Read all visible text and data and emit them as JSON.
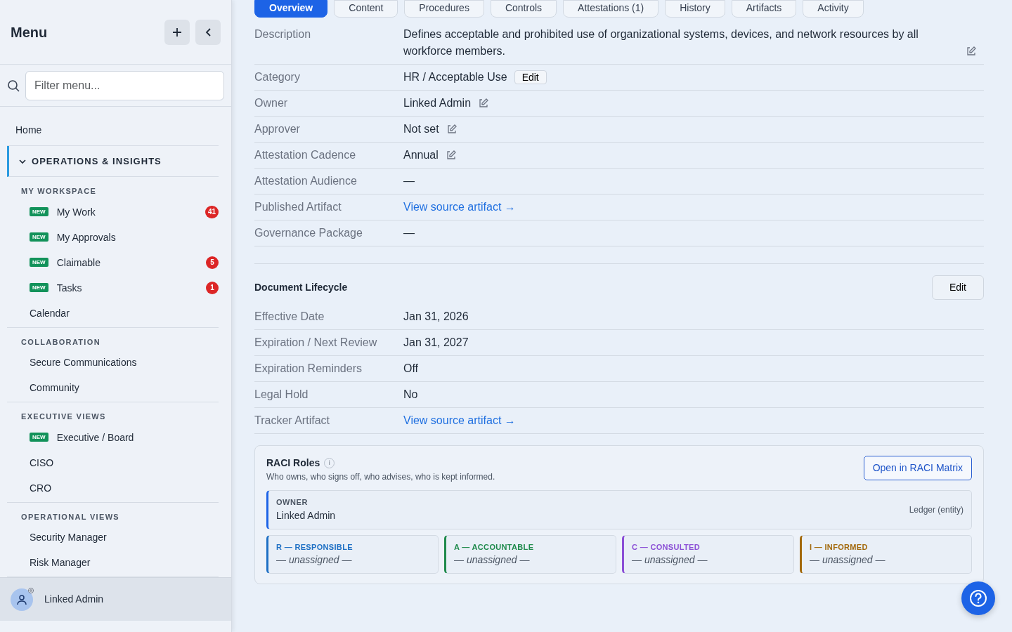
{
  "sidebar": {
    "title": "Menu",
    "filter": {
      "placeholder": "Filter menu..."
    },
    "home": "Home",
    "group": {
      "label": "OPERATIONS & INSIGHTS",
      "expanded": true
    },
    "sections": [
      {
        "title": "MY WORKSPACE",
        "items": [
          {
            "label": "My Work",
            "tag": "NEW",
            "count": "41"
          },
          {
            "label": "My Approvals",
            "tag": "NEW"
          },
          {
            "label": "Claimable",
            "tag": "NEW",
            "count": "5"
          },
          {
            "label": "Tasks",
            "tag": "NEW",
            "count": "1"
          },
          {
            "label": "Calendar"
          }
        ]
      },
      {
        "title": "COLLABORATION",
        "items": [
          {
            "label": "Secure Communications"
          },
          {
            "label": "Community"
          }
        ]
      },
      {
        "title": "EXECUTIVE VIEWS",
        "items": [
          {
            "label": "Executive / Board",
            "tag": "NEW"
          },
          {
            "label": "CISO"
          },
          {
            "label": "CRO"
          }
        ]
      },
      {
        "title": "OPERATIONAL VIEWS",
        "items": [
          {
            "label": "Security Manager"
          },
          {
            "label": "Risk Manager"
          }
        ]
      }
    ],
    "user": "Linked Admin"
  },
  "tabs": [
    {
      "label": "Overview",
      "selected": true
    },
    {
      "label": "Content",
      "selected": false
    },
    {
      "label": "Procedures",
      "selected": false
    },
    {
      "label": "Controls",
      "selected": false
    },
    {
      "label": "Attestations (1)",
      "selected": false
    },
    {
      "label": "History",
      "selected": false
    },
    {
      "label": "Artifacts",
      "selected": false
    },
    {
      "label": "Activity",
      "selected": false
    }
  ],
  "details": [
    {
      "label": "Description",
      "value": "Defines acceptable and prohibited use of organizational systems, devices, and network resources by all workforce members.",
      "kind": "editable"
    },
    {
      "label": "Category",
      "value": "HR / Acceptable Use",
      "kind": "button",
      "button": "Edit"
    },
    {
      "label": "Owner",
      "value": "Linked Admin",
      "kind": "editable"
    },
    {
      "label": "Approver",
      "value": "Not set",
      "kind": "editable"
    },
    {
      "label": "Attestation Cadence",
      "value": "Annual",
      "kind": "editable"
    },
    {
      "label": "Attestation Audience",
      "value": "—",
      "kind": "text"
    },
    {
      "label": "Published Artifact",
      "value": "View source artifact →",
      "kind": "link"
    },
    {
      "label": "Governance Package",
      "value": "—",
      "kind": "text"
    }
  ],
  "lifecycle": {
    "title": "Document Lifecycle",
    "button": "Edit",
    "rows": [
      {
        "label": "Effective Date",
        "value": "Jan 31, 2026",
        "kind": "text"
      },
      {
        "label": "Expiration / Next Review",
        "value": "Jan 31, 2027",
        "kind": "text"
      },
      {
        "label": "Expiration Reminders",
        "value": "Off",
        "kind": "text"
      },
      {
        "label": "Legal Hold",
        "value": "No",
        "kind": "text"
      },
      {
        "label": "Tracker Artifact",
        "value": "View source artifact →",
        "kind": "link"
      }
    ]
  },
  "raci": {
    "title": "RACI Roles",
    "info": "i",
    "subtitle": "Who owns, who signs off, who advises, who is kept informed.",
    "button": "Open in RACI Matrix",
    "owner": {
      "label": "OWNER",
      "name": "Linked Admin",
      "source": "Ledger (entity)"
    },
    "roles": [
      {
        "label": "R — RESPONSIBLE",
        "value": "— unassigned —",
        "color": "#1d6fc4"
      },
      {
        "label": "A — ACCOUNTABLE",
        "value": "— unassigned —",
        "color": "#1f8a4c"
      },
      {
        "label": "C — CONSULTED",
        "value": "— unassigned —",
        "color": "#8b4fd6"
      },
      {
        "label": "I — INFORMED",
        "value": "— unassigned —",
        "color": "#a3690c"
      }
    ]
  }
}
